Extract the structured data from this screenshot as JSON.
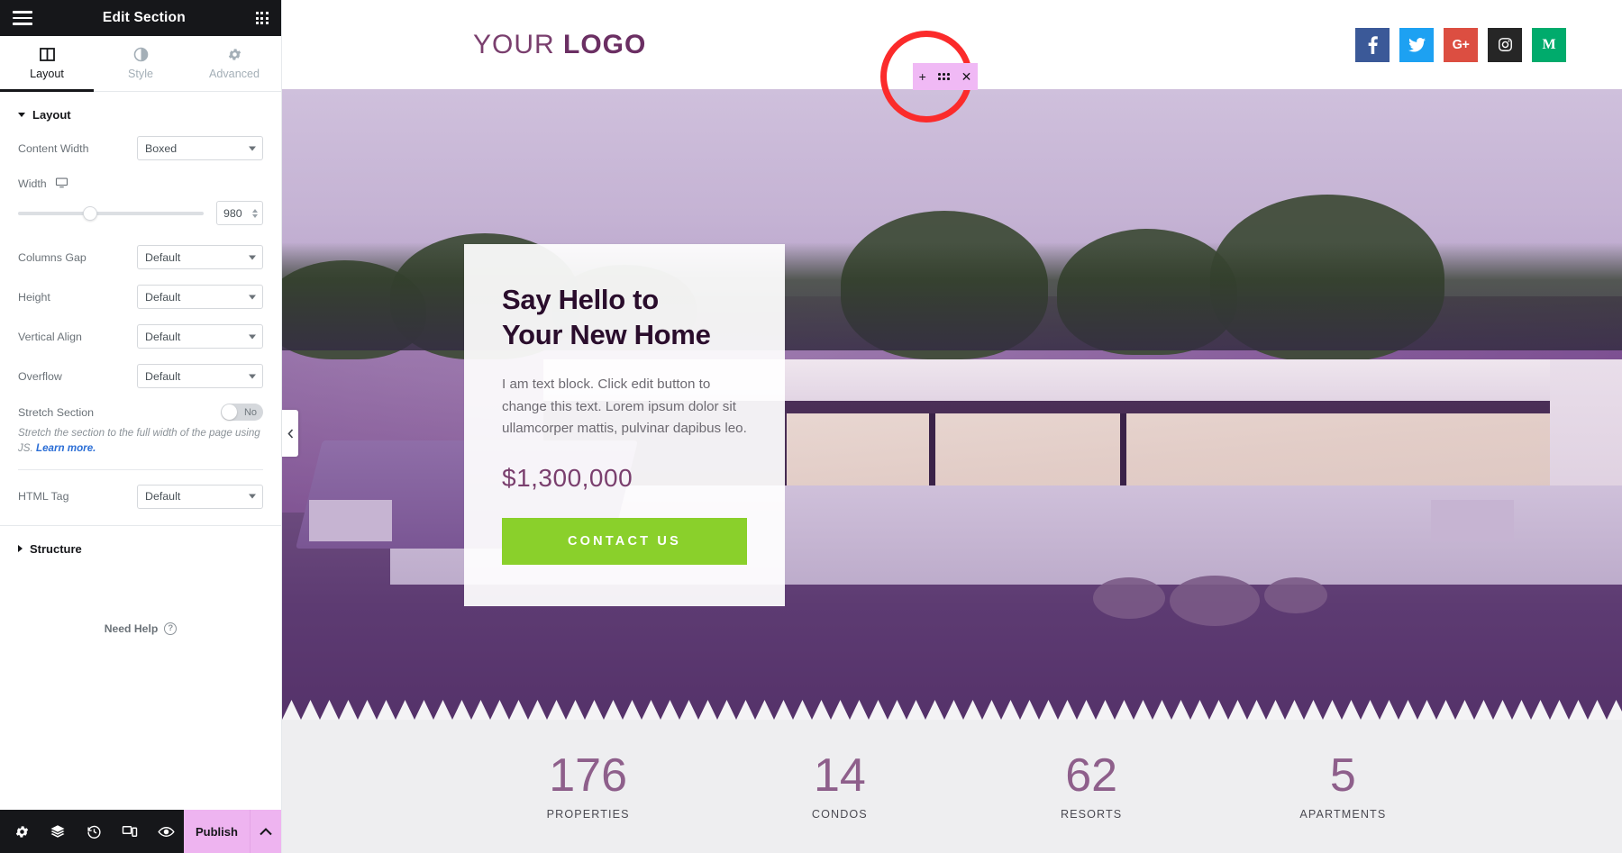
{
  "panel": {
    "title": "Edit Section",
    "menu_icon": "hamburger-icon",
    "apps_icon": "grid-apps-icon",
    "tabs": [
      {
        "label": "Layout",
        "icon": "layout-columns-icon",
        "active": true
      },
      {
        "label": "Style",
        "icon": "contrast-circle-icon",
        "active": false
      },
      {
        "label": "Advanced",
        "icon": "gear-icon",
        "active": false
      }
    ],
    "layout_section": {
      "heading": "Layout",
      "content_width": {
        "label": "Content Width",
        "value": "Boxed"
      },
      "width": {
        "label": "Width",
        "device_icon": "desktop-icon",
        "value": "980",
        "slider_percent": 39
      },
      "columns_gap": {
        "label": "Columns Gap",
        "value": "Default"
      },
      "height": {
        "label": "Height",
        "value": "Default"
      },
      "vertical_align": {
        "label": "Vertical Align",
        "value": "Default"
      },
      "overflow": {
        "label": "Overflow",
        "value": "Default"
      },
      "stretch_section": {
        "label": "Stretch Section",
        "value": "No"
      },
      "stretch_help": "Stretch the section to the full width of the page using JS.",
      "stretch_help_link": "Learn more.",
      "html_tag": {
        "label": "HTML Tag",
        "value": "Default"
      }
    },
    "structure_section": {
      "heading": "Structure"
    },
    "need_help": {
      "label": "Need Help",
      "icon": "question-circle-icon"
    },
    "footer": {
      "icons": [
        {
          "name": "settings-gear-icon"
        },
        {
          "name": "navigator-layers-icon"
        },
        {
          "name": "history-revisions-icon"
        },
        {
          "name": "responsive-mode-icon"
        },
        {
          "name": "preview-eye-icon"
        }
      ],
      "publish_label": "Publish",
      "publish_caret_icon": "chevron-up-icon",
      "publish_color": "#eeb4f0"
    },
    "collapse_tab_icon": "chevron-left-icon"
  },
  "canvas": {
    "site_header": {
      "logo_first": "YOUR ",
      "logo_second": "LOGO",
      "socials": [
        {
          "name": "facebook-icon",
          "glyph": "f",
          "color": "#3b5998"
        },
        {
          "name": "twitter-icon",
          "glyph": "t",
          "color": "#1da1f2"
        },
        {
          "name": "google-plus-icon",
          "glyph": "G+",
          "color": "#dc4e41"
        },
        {
          "name": "instagram-icon",
          "glyph": "ig",
          "color": "#262626"
        },
        {
          "name": "medium-icon",
          "glyph": "M",
          "color": "#00ab6c"
        }
      ]
    },
    "section_handle": {
      "add_icon": "plus-icon",
      "drag_icon": "drag-dots-icon",
      "close_icon": "close-x-icon",
      "highlight_color": "#fb2b2b",
      "background": "#f0b9f5"
    },
    "hero": {
      "heading_line1": "Say Hello to",
      "heading_line2": "Your New Home",
      "paragraph": "I am text block. Click edit button to change this text. Lorem ipsum dolor sit ullamcorper mattis, pulvinar dapibus leo.",
      "price": "$1,300,000",
      "cta_label": "CONTACT US",
      "cta_color": "#8ad02b"
    },
    "stats": [
      {
        "number": "176",
        "label": "PROPERTIES"
      },
      {
        "number": "14",
        "label": "CONDOS"
      },
      {
        "number": "62",
        "label": "RESORTS"
      },
      {
        "number": "5",
        "label": "APARTMENTS"
      }
    ]
  }
}
